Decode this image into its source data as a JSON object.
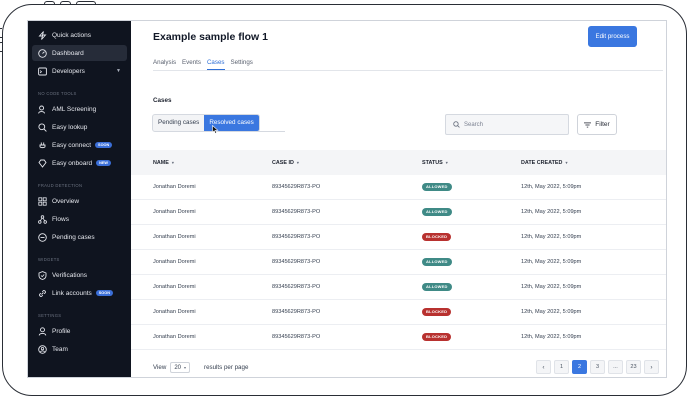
{
  "sidebar": {
    "items_top": [
      {
        "label": "Quick actions",
        "icon": "lightning-icon"
      },
      {
        "label": "Dashboard",
        "icon": "gauge-icon",
        "active": true
      },
      {
        "label": "Developers",
        "icon": "terminal-icon",
        "has_dropdown": true
      }
    ],
    "sections": [
      {
        "title": "NO CODE TOOLS",
        "items": [
          {
            "label": "AML Screening",
            "icon": "user-search-icon"
          },
          {
            "label": "Easy lookup",
            "icon": "search-icon"
          },
          {
            "label": "Easy connect",
            "icon": "plug-icon",
            "badge": "SOON"
          },
          {
            "label": "Easy onboard",
            "icon": "diamond-icon",
            "badge": "NEW"
          }
        ]
      },
      {
        "title": "FRAUD DETECTION",
        "items": [
          {
            "label": "Overview",
            "icon": "grid-icon"
          },
          {
            "label": "Flows",
            "icon": "flow-icon"
          },
          {
            "label": "Pending cases",
            "icon": "clock-icon"
          }
        ]
      },
      {
        "title": "WIDGETS",
        "items": [
          {
            "label": "Verifications",
            "icon": "shield-check-icon"
          },
          {
            "label": "Link accounts",
            "icon": "link-icon",
            "badge": "SOON"
          }
        ]
      },
      {
        "title": "SETTINGS",
        "items": [
          {
            "label": "Profile",
            "icon": "user-icon"
          },
          {
            "label": "Team",
            "icon": "team-icon"
          }
        ]
      }
    ]
  },
  "header": {
    "title": "Example sample flow 1",
    "edit_button": "Edit process"
  },
  "tabs": [
    {
      "label": "Analysis"
    },
    {
      "label": "Events"
    },
    {
      "label": "Cases",
      "active": true
    },
    {
      "label": "Settings"
    }
  ],
  "cases": {
    "label": "Cases",
    "segments": [
      {
        "label": "Pending cases"
      },
      {
        "label": "Resolved cases",
        "active": true
      }
    ],
    "search_placeholder": "Search",
    "filter_label": "Filter"
  },
  "table": {
    "columns": [
      "NAME",
      "CASE ID",
      "STATUS",
      "DATE CREATED"
    ],
    "rows": [
      {
        "name": "Jonathan Doremi",
        "case_id": "89345629R873-PO",
        "status": "ALLOWED",
        "date": "12th, May 2022, 5:09pm"
      },
      {
        "name": "Jonathan Doremi",
        "case_id": "89345629R873-PO",
        "status": "ALLOWED",
        "date": "12th, May 2022, 5:09pm"
      },
      {
        "name": "Jonathan Doremi",
        "case_id": "89345629R873-PO",
        "status": "BLOCKED",
        "date": "12th, May 2022, 5:09pm"
      },
      {
        "name": "Jonathan Doremi",
        "case_id": "89345629R873-PO",
        "status": "ALLOWED",
        "date": "12th, May 2022, 5:09pm"
      },
      {
        "name": "Jonathan Doremi",
        "case_id": "89345629R873-PO",
        "status": "ALLOWED",
        "date": "12th, May 2022, 5:09pm"
      },
      {
        "name": "Jonathan Doremi",
        "case_id": "89345629R873-PO",
        "status": "BLOCKED",
        "date": "12th, May 2022, 5:09pm"
      },
      {
        "name": "Jonathan Doremi",
        "case_id": "89345629R873-PO",
        "status": "BLOCKED",
        "date": "12th, May 2022, 5:09pm"
      }
    ],
    "status_colors": {
      "ALLOWED": "#3f8a86",
      "BLOCKED": "#b8312f"
    }
  },
  "footer": {
    "view_label": "View",
    "per_page": "20",
    "per_page_suffix": "results per page",
    "pages": [
      "1",
      "2",
      "3",
      "...",
      "23"
    ],
    "current_page": "2"
  },
  "colors": {
    "sidebar_bg": "#0f141f",
    "accent": "#3a77e0"
  }
}
